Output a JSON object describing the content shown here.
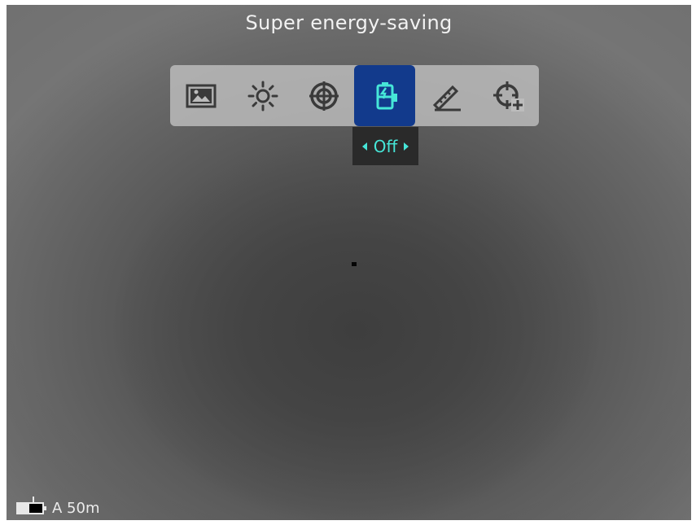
{
  "header": {
    "title": "Super energy-saving"
  },
  "menu": {
    "items": [
      {
        "icon": "image-mode-icon",
        "active": false
      },
      {
        "icon": "brightness-icon",
        "active": false
      },
      {
        "icon": "reticle-icon",
        "active": false
      },
      {
        "icon": "energy-saving-icon",
        "active": true
      },
      {
        "icon": "ruler-pencil-icon",
        "active": false
      },
      {
        "icon": "crosshair-plus-icon",
        "active": false
      }
    ],
    "selected_value": "Off"
  },
  "status_bar": {
    "mode_distance": "A 50m"
  },
  "colors": {
    "active_tile": "#123a8c",
    "value_text": "#46e6d8",
    "icon_stroke": "#3a3a3a"
  }
}
